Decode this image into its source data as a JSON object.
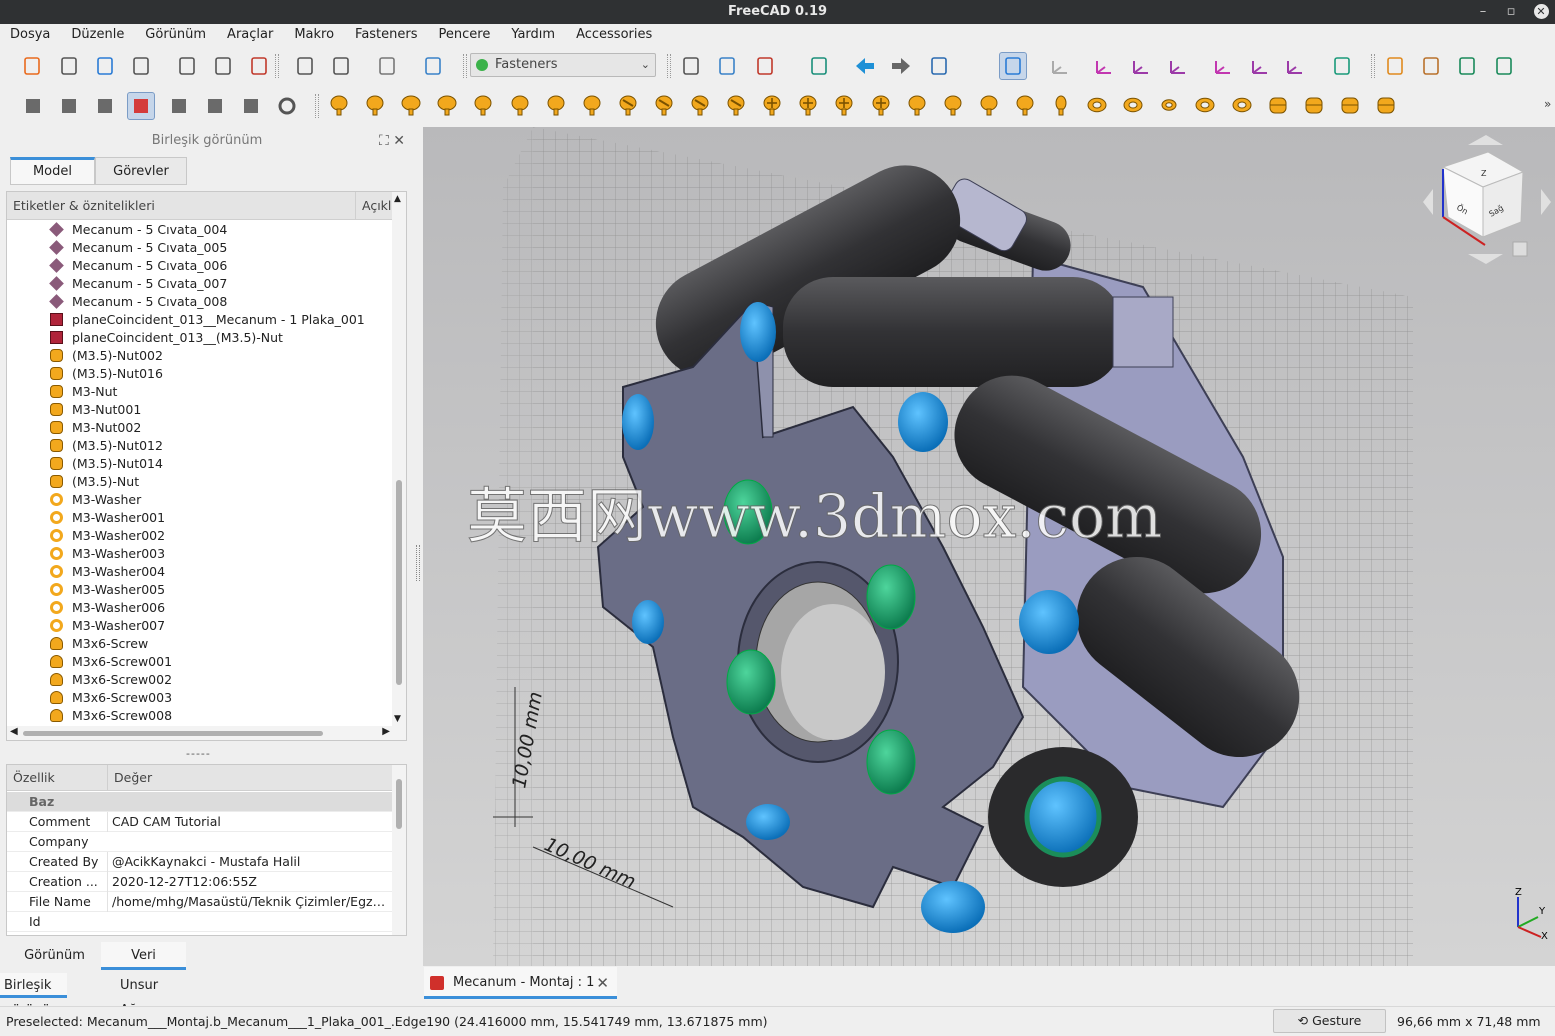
{
  "window": {
    "title": "FreeCAD 0.19",
    "minimize": "–",
    "maximize": "▫",
    "close": "✕"
  },
  "menu": [
    "Dosya",
    "Düzenle",
    "Görünüm",
    "Araçlar",
    "Makro",
    "Fasteners",
    "Pencere",
    "Yardım",
    "Accessories"
  ],
  "toolbar": {
    "workbench": "Fasteners",
    "row1_icons": [
      "new-document-icon",
      "open-icon",
      "save-icon",
      "print-icon",
      "cut-icon",
      "copy-icon",
      "paste-icon",
      "undo-icon",
      "redo-icon",
      "refresh-icon",
      "whats-this-icon",
      "fit-all-icon",
      "fit-selection-icon",
      "draw-style-icon",
      "std-views-icon",
      "back-icon",
      "forward-icon",
      "measure-box-icon",
      "view-zoom-icon",
      "axonometric-icon",
      "front-view-icon",
      "top-view-icon",
      "right-view-icon",
      "rear-view-icon",
      "bottom-view-icon",
      "left-view-icon",
      "measure-icon",
      "macro-import-icon",
      "folder-icon",
      "export-icon",
      "export-part-icon"
    ],
    "row2_icons": [
      "move-fastener-icon",
      "flip-fastener-icon",
      "shape-icon",
      "match-fastener-icon",
      "list-icon",
      "bom-calculator-icon",
      "fastener-set-icon",
      "gear-icon"
    ]
  },
  "fastener_icons": [
    {
      "kind": "hex-screw",
      "shape": "screw"
    },
    {
      "kind": "cap-screw",
      "shape": "screw"
    },
    {
      "kind": "button-screw",
      "shape": "screw-wide"
    },
    {
      "kind": "flange-screw",
      "shape": "screw-wide"
    },
    {
      "kind": "pan-screw",
      "shape": "screw"
    },
    {
      "kind": "cheese-screw",
      "shape": "screw"
    },
    {
      "kind": "socket-screw",
      "shape": "screw"
    },
    {
      "kind": "countersunk-screw",
      "shape": "screw"
    },
    {
      "kind": "slotted-screw",
      "shape": "slotted"
    },
    {
      "kind": "slotted-screw-2",
      "shape": "slotted"
    },
    {
      "kind": "slotted-screw-3",
      "shape": "slotted"
    },
    {
      "kind": "slotted-screw-4",
      "shape": "slotted"
    },
    {
      "kind": "phillips-screw",
      "shape": "cross"
    },
    {
      "kind": "phillips-screw-2",
      "shape": "cross"
    },
    {
      "kind": "phillips-screw-3",
      "shape": "cross"
    },
    {
      "kind": "phillips-screw-4",
      "shape": "cross"
    },
    {
      "kind": "torx-screw",
      "shape": "screw"
    },
    {
      "kind": "torx-screw-2",
      "shape": "screw"
    },
    {
      "kind": "hex-socket-screw",
      "shape": "screw"
    },
    {
      "kind": "hex-socket-screw-2",
      "shape": "screw"
    },
    {
      "kind": "set-screw",
      "shape": "screw-small"
    },
    {
      "kind": "washer",
      "shape": "washer"
    },
    {
      "kind": "washer-2",
      "shape": "washer"
    },
    {
      "kind": "washer-small",
      "shape": "washer-small"
    },
    {
      "kind": "washer-flat",
      "shape": "washer"
    },
    {
      "kind": "washer-spring",
      "shape": "washer"
    },
    {
      "kind": "hex-nut",
      "shape": "nut"
    },
    {
      "kind": "hex-nut-2",
      "shape": "nut"
    },
    {
      "kind": "cap-nut",
      "shape": "nut"
    },
    {
      "kind": "flange-nut",
      "shape": "nut"
    }
  ],
  "combo_view": {
    "title": "Birleşik görünüm",
    "tabs": [
      "Model",
      "Görevler"
    ],
    "tree_header": [
      "Etiketler & öznitelikleri",
      "Açıklama"
    ],
    "tree_items": [
      {
        "label": "Mecanum - 5 Cıvata_004",
        "icon": "part-icon"
      },
      {
        "label": "Mecanum - 5 Cıvata_005",
        "icon": "part-icon"
      },
      {
        "label": "Mecanum - 5 Cıvata_006",
        "icon": "part-icon"
      },
      {
        "label": "Mecanum - 5 Cıvata_007",
        "icon": "part-icon"
      },
      {
        "label": "Mecanum - 5 Cıvata_008",
        "icon": "part-icon"
      },
      {
        "label": "planeCoincident_013__Mecanum - 1 Plaka_001",
        "icon": "constraint-icon"
      },
      {
        "label": "planeCoincident_013__(M3.5)-Nut",
        "icon": "constraint-icon"
      },
      {
        "label": "(M3.5)-Nut002",
        "icon": "nut-icon"
      },
      {
        "label": "(M3.5)-Nut016",
        "icon": "nut-icon"
      },
      {
        "label": "M3-Nut",
        "icon": "nut-icon"
      },
      {
        "label": "M3-Nut001",
        "icon": "nut-icon"
      },
      {
        "label": "M3-Nut002",
        "icon": "nut-icon"
      },
      {
        "label": "(M3.5)-Nut012",
        "icon": "nut-icon"
      },
      {
        "label": "(M3.5)-Nut014",
        "icon": "nut-icon"
      },
      {
        "label": "(M3.5)-Nut",
        "icon": "nut-icon"
      },
      {
        "label": "M3-Washer",
        "icon": "washer-icon"
      },
      {
        "label": "M3-Washer001",
        "icon": "washer-icon"
      },
      {
        "label": "M3-Washer002",
        "icon": "washer-icon"
      },
      {
        "label": "M3-Washer003",
        "icon": "washer-icon"
      },
      {
        "label": "M3-Washer004",
        "icon": "washer-icon"
      },
      {
        "label": "M3-Washer005",
        "icon": "washer-icon"
      },
      {
        "label": "M3-Washer006",
        "icon": "washer-icon"
      },
      {
        "label": "M3-Washer007",
        "icon": "washer-icon"
      },
      {
        "label": "M3x6-Screw",
        "icon": "screw-icon"
      },
      {
        "label": "M3x6-Screw001",
        "icon": "screw-icon"
      },
      {
        "label": "M3x6-Screw002",
        "icon": "screw-icon"
      },
      {
        "label": "M3x6-Screw003",
        "icon": "screw-icon"
      },
      {
        "label": "M3x6-Screw008",
        "icon": "screw-icon"
      }
    ],
    "splitter": "-----",
    "property_header": [
      "Özellik",
      "Değer"
    ],
    "property_group": "Baz",
    "properties": [
      {
        "key": "Comment",
        "value": "CAD CAM Tutorial"
      },
      {
        "key": "Company",
        "value": ""
      },
      {
        "key": "Created By",
        "value": "@AcikKaynakci - Mustafa Halil"
      },
      {
        "key": "Creation ...",
        "value": "2020-12-27T12:06:55Z"
      },
      {
        "key": "File Name",
        "value": "/home/mhg/Masaüstü/Teknik Çizimler/Egzer..."
      },
      {
        "key": "Id",
        "value": ""
      }
    ],
    "property_tabs": [
      "Görünüm",
      "Veri"
    ],
    "bottom_tabs": [
      "Birleşik görünüm",
      "Unsur Ağacı"
    ]
  },
  "viewport": {
    "watermark": "莫西网www.3dmox.com",
    "dim_vertical": "10,00 mm",
    "dim_horizontal": "10,00 mm",
    "navcube": {
      "top": "Z",
      "front": "Ön",
      "right": "Sağ"
    },
    "axes": {
      "x": "X",
      "y": "Y",
      "z": "Z"
    }
  },
  "document_tab": "Mecanum - Montaj : 1",
  "status": {
    "message": "Preselected: Mecanum___Montaj.b_Mecanum___1_Plaka_001_.Edge190 (24.416000 mm, 15.541749 mm, 13.671875 mm)",
    "navigation": "Gesture",
    "dimensions": "96,66 mm x 71,48 mm"
  },
  "colors": {
    "accent": "#3b8fd9",
    "plate": "#6a6d86",
    "roller": "#3c3c3e",
    "screw_blue": "#1e8fd8",
    "screw_green": "#1fa86e",
    "fastener_gold": "#f2a81d"
  }
}
